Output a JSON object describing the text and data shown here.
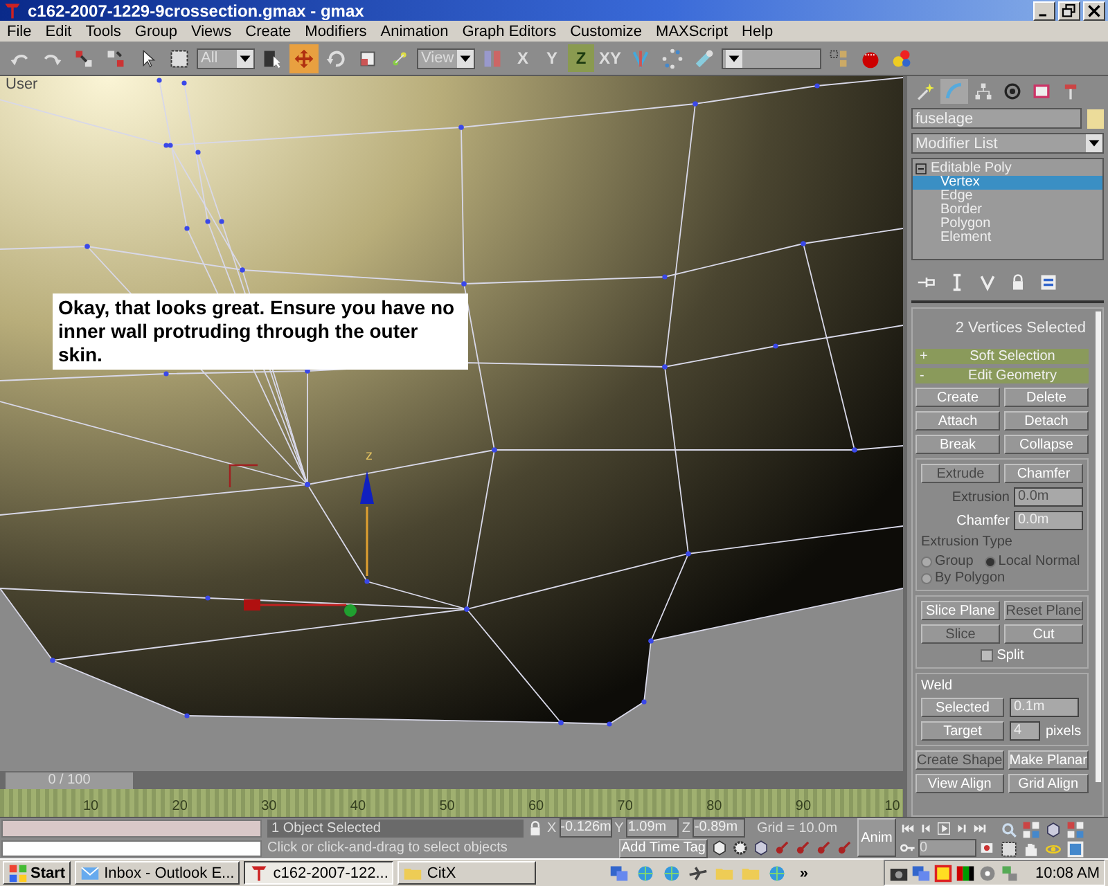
{
  "window": {
    "title": "c162-2007-1229-9crossection.gmax - gmax"
  },
  "menu": [
    "File",
    "Edit",
    "Tools",
    "Group",
    "Views",
    "Create",
    "Modifiers",
    "Animation",
    "Graph Editors",
    "Customize",
    "MAXScript",
    "Help"
  ],
  "toolbar": [
    {
      "kind": "tool",
      "selected": false
    },
    {
      "kind": "tool",
      "selected": false
    },
    {
      "kind": "tool",
      "selected": false
    },
    {
      "kind": "tool",
      "selected": false
    },
    {
      "kind": "tool",
      "selected": false
    },
    {
      "kind": "tool",
      "selected": false
    },
    {
      "kind": "dropdown",
      "value": "All"
    },
    {
      "kind": "tool",
      "selected": false
    },
    {
      "kind": "tool",
      "selected": true
    },
    {
      "kind": "tool",
      "selected": false
    },
    {
      "kind": "tool",
      "selected": false
    },
    {
      "kind": "tool",
      "selected": false
    },
    {
      "kind": "dropdown",
      "value": "View"
    },
    {
      "kind": "tool",
      "selected": false
    },
    {
      "kind": "axis",
      "label": "X",
      "selected": false
    },
    {
      "kind": "axis",
      "label": "Y",
      "selected": false
    },
    {
      "kind": "axis",
      "label": "Z",
      "selected": true
    },
    {
      "kind": "axis",
      "label": "XY",
      "selected": false
    },
    {
      "kind": "tool",
      "selected": false
    },
    {
      "kind": "tool",
      "selected": false
    },
    {
      "kind": "tool",
      "selected": false
    },
    {
      "kind": "dropdown"
    },
    {
      "kind": "tool",
      "selected": false
    },
    {
      "kind": "tool",
      "selected": false
    },
    {
      "kind": "tool",
      "selected": false
    }
  ],
  "viewport": {
    "label": "User",
    "note": "Okay, that looks great.  Ensure you have no inner wall protruding through the outer skin.",
    "gizmo_label": "z"
  },
  "time_slider": {
    "label": "0 / 100"
  },
  "trackbar": {
    "ticks": [
      "10",
      "20",
      "30",
      "40",
      "50",
      "60",
      "70",
      "80",
      "90",
      "10"
    ]
  },
  "command_panel": {
    "tabs": [
      {
        "selected": false
      },
      {
        "selected": true
      },
      {
        "selected": false
      },
      {
        "selected": false
      },
      {
        "selected": false
      },
      {
        "selected": false
      }
    ],
    "object_name": "fuselage",
    "modifier_list": "Modifier List",
    "stack": [
      {
        "label": "Editable Poly",
        "selected": false,
        "children": [
          {
            "label": "Vertex",
            "selected": true
          },
          {
            "label": "Edge",
            "selected": false
          },
          {
            "label": "Border",
            "selected": false
          },
          {
            "label": "Polygon",
            "selected": false
          },
          {
            "label": "Element",
            "selected": false
          }
        ]
      }
    ],
    "selection_info": "2 Vertices Selected",
    "rollouts": [
      {
        "sign": "+",
        "label": "Soft Selection"
      },
      {
        "sign": "-",
        "label": "Edit Geometry"
      }
    ],
    "edit_geometry": {
      "buttons": [
        {
          "label": "Create",
          "disabled": false
        },
        {
          "label": "Delete",
          "disabled": false
        },
        {
          "label": "Attach",
          "disabled": false
        },
        {
          "label": "Detach",
          "disabled": false
        },
        {
          "label": "Break",
          "disabled": false
        },
        {
          "label": "Collapse",
          "disabled": false
        }
      ],
      "extrude_group": {
        "buttons": [
          {
            "label": "Extrude",
            "disabled": true
          },
          {
            "label": "Chamfer",
            "disabled": false
          }
        ],
        "fields": [
          {
            "label": "Extrusion",
            "value": "0.0m",
            "disabled": true
          },
          {
            "label": "Chamfer",
            "value": "0.0m",
            "disabled": false
          }
        ],
        "extrusion_type": {
          "label": "Extrusion Type",
          "disabled": true,
          "options": [
            {
              "label": "Group",
              "selected": false
            },
            {
              "label": "Local Normal",
              "selected": true
            },
            {
              "label": "By Polygon",
              "selected": false
            }
          ]
        }
      },
      "slice_group": {
        "buttons": [
          {
            "label": "Slice Plane",
            "disabled": false
          },
          {
            "label": "Reset Plane",
            "disabled": true
          },
          {
            "label": "Slice",
            "disabled": true
          },
          {
            "label": "Cut",
            "disabled": false
          }
        ],
        "split": {
          "label": "Split",
          "checked": false
        }
      },
      "weld": {
        "title": "Weld",
        "rows": [
          {
            "button": "Selected",
            "value": "0.1m"
          },
          {
            "button": "Target",
            "value": "4",
            "unit": "pixels"
          }
        ]
      },
      "bottom_buttons": [
        {
          "label": "Create Shape",
          "disabled": true
        },
        {
          "label": "Make Planar",
          "disabled": false
        },
        {
          "label": "View Align",
          "disabled": false
        },
        {
          "label": "Grid Align",
          "disabled": false
        }
      ]
    }
  },
  "status_bar": {
    "selection": "1 Object Selected",
    "prompt": "Click or click-and-drag to select objects",
    "coords": [
      {
        "axis": "X",
        "value": "-0.126m"
      },
      {
        "axis": "Y",
        "value": "1.09m"
      },
      {
        "axis": "Z",
        "value": "-0.89m"
      }
    ],
    "grid": "Grid = 10.0m",
    "time_tag": "Add Time Tag",
    "anim": "Anim",
    "frame": "0"
  },
  "taskbar": {
    "start": "Start",
    "tasks": [
      {
        "label": "Inbox - Outlook E...",
        "selected": false
      },
      {
        "label": "c162-2007-122...",
        "selected": true
      },
      {
        "label": "CitX",
        "selected": false
      }
    ],
    "chevron": "»",
    "clock": "10:08 AM"
  }
}
